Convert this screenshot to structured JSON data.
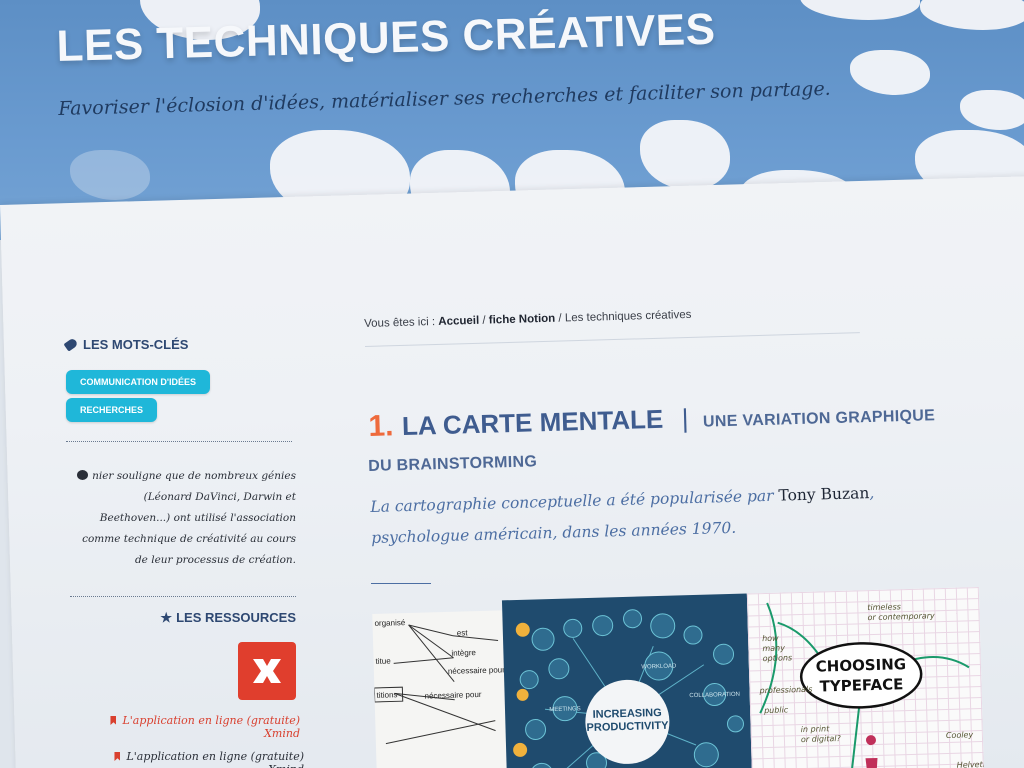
{
  "header": {
    "title": "LES TECHNIQUES CRÉATIVES",
    "subtitle": "Favoriser l'éclosion d'idées, matérialiser ses recherches et faciliter son partage."
  },
  "sidebar": {
    "keywords_heading": "LES MOTS-CLÉS",
    "keywords": [
      "COMMUNICATION D'IDÉES",
      "RECHERCHES"
    ],
    "quote": "nier souligne que de nombreux génies (Léonard DaVinci, Darwin et Beethoven...) ont utilisé l'association comme technique de créativité au cours de leur processus de création.",
    "resources_heading": "LES RESSOURCES",
    "resources": [
      "L'application en ligne (gratuite) Xmind",
      "L'application en ligne (gratuite) Xmind"
    ]
  },
  "breadcrumb": {
    "prefix": "Vous êtes ici :",
    "home": "Accueil",
    "sep1": "/",
    "section": "fiche Notion",
    "sep2": "/",
    "current": "Les techniques créatives"
  },
  "article": {
    "number": "1.",
    "title": "LA CARTE MENTALE",
    "separator": "|",
    "subtitle_part1": "UNE VARIATION GRAPHIQUE",
    "subtitle_part2": "DU BRAINSTORMING",
    "lead_before": "La cartographie conceptuelle a été popularisée par",
    "lead_name": "Tony Buzan",
    "lead_after": ", psychologue américain, dans les années 1970."
  },
  "images": {
    "img1_labels": [
      "organisé",
      "est",
      "intègre",
      "nécessaire pour",
      "nécessaire pour",
      "titions",
      "titue"
    ],
    "img2_label_1": "INCREASING",
    "img2_label_2": "PRODUCTIVITY",
    "img2_small": [
      "WORKLOAD",
      "COLLABORATION",
      "MEETINGS"
    ],
    "img3_label_1": "CHOOSING",
    "img3_label_2": "TYPEFACE"
  },
  "colors": {
    "accent_orange": "#ee6a3c",
    "title_blue": "#3f5c8f",
    "chip_cyan": "#1fb7d9",
    "resource_red": "#d9402f"
  }
}
